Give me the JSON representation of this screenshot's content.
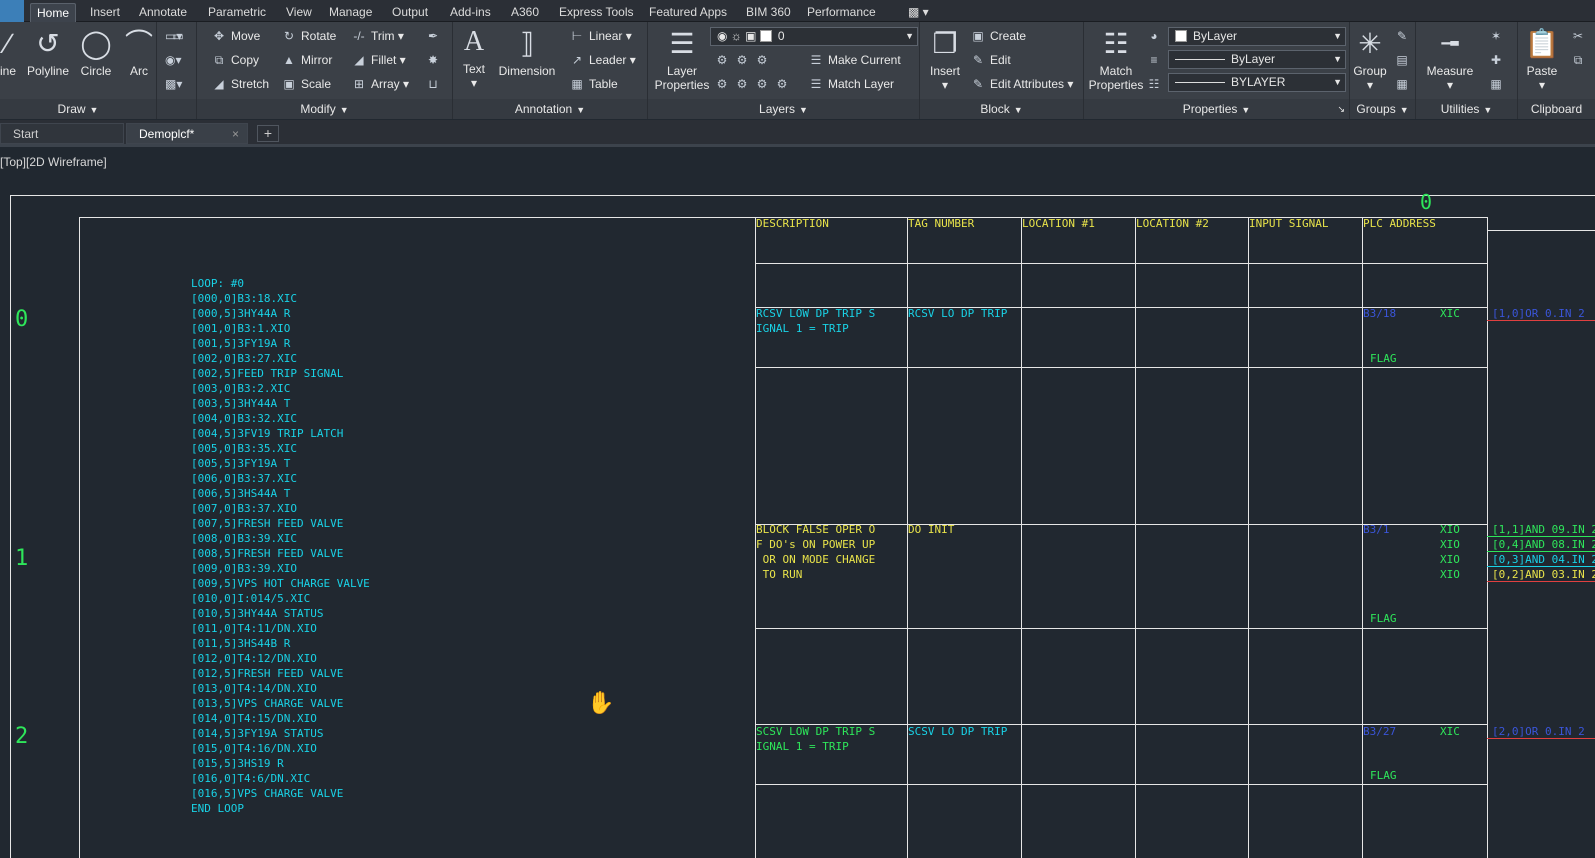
{
  "menu_tabs": [
    "Home",
    "Insert",
    "Annotate",
    "Parametric",
    "View",
    "Manage",
    "Output",
    "Add-ins",
    "A360",
    "Express Tools",
    "Featured Apps",
    "BIM 360",
    "Performance"
  ],
  "ribbon": {
    "draw": {
      "title": "Draw",
      "line": "ine",
      "polyline": "Polyline",
      "circle": "Circle",
      "arc": "Arc"
    },
    "modify": {
      "title": "Modify",
      "move": "Move",
      "rotate": "Rotate",
      "trim": "Trim",
      "copy": "Copy",
      "mirror": "Mirror",
      "fillet": "Fillet",
      "stretch": "Stretch",
      "scale": "Scale",
      "array": "Array"
    },
    "annotation": {
      "title": "Annotation",
      "text": "Text",
      "dimension": "Dimension",
      "linear": "Linear",
      "leader": "Leader",
      "table": "Table"
    },
    "layers": {
      "title": "Layers",
      "layer_properties_1": "Layer",
      "layer_properties_2": "Properties",
      "current_layer": "0",
      "make_current": "Make Current",
      "match_layer": "Match Layer"
    },
    "block": {
      "title": "Block",
      "insert": "Insert",
      "create": "Create",
      "edit": "Edit",
      "edit_attributes": "Edit Attributes"
    },
    "properties": {
      "title": "Properties",
      "match_1": "Match",
      "match_2": "Properties",
      "color": "ByLayer",
      "linetype": "ByLayer",
      "lineweight": "BYLAYER"
    },
    "groups": {
      "title": "Groups",
      "group": "Group"
    },
    "utilities": {
      "title": "Utilities",
      "measure": "Measure"
    },
    "clipboard": {
      "title": "Clipboard",
      "paste": "Paste"
    }
  },
  "doc_tabs": {
    "start": "Start",
    "active": "Demoplcf*",
    "close": "×",
    "add": "+"
  },
  "viewport_label": "[Top][2D Wireframe]",
  "rung_numbers": [
    "0",
    "1",
    "2"
  ],
  "top_marker": "0",
  "loop_text": [
    "LOOP: #0",
    "[000,0]B3:18.XIC",
    "[000,5]3HY44A R",
    "[001,0]B3:1.XIO",
    "[001,5]3FY19A R",
    "[002,0]B3:27.XIC",
    "[002,5]FEED TRIP SIGNAL",
    "[003,0]B3:2.XIC",
    "[003,5]3HY44A T",
    "[004,0]B3:32.XIC",
    "[004,5]3FV19 TRIP LATCH",
    "[005,0]B3:35.XIC",
    "[005,5]3FY19A T",
    "[006,0]B3:37.XIC",
    "[006,5]3HS44A T",
    "[007,0]B3:37.XIO",
    "[007,5]FRESH FEED VALVE",
    "[008,0]B3:39.XIC",
    "[008,5]FRESH FEED VALVE",
    "[009,0]B3:39.XIO",
    "[009,5]VPS HOT CHARGE VALVE",
    "[010,0]I:014/5.XIC",
    "[010,5]3HY44A STATUS",
    "[011,0]T4:11/DN.XIO",
    "[011,5]3HS44B R",
    "[012,0]T4:12/DN.XIO",
    "[012,5]FRESH FEED VALVE",
    "[013,0]T4:14/DN.XIO",
    "[013,5]VPS CHARGE VALVE",
    "[014,0]T4:15/DN.XIO",
    "[014,5]3FY19A STATUS",
    "[015,0]T4:16/DN.XIO",
    "[015,5]3HS19 R",
    "[016,0]T4:6/DN.XIC",
    "[016,5]VPS CHARGE VALVE",
    "END LOOP"
  ],
  "table_headers": [
    "DESCRIPTION",
    "TAG NUMBER",
    "LOCATION #1",
    "LOCATION #2",
    "INPUT SIGNAL",
    "PLC ADDRESS"
  ],
  "rows": [
    {
      "description": "RCSV LOW DP TRIP S\nIGNAL 1 = TRIP",
      "tag": "RCSV LO DP TRIP",
      "address": "B3/18",
      "instr": "XIC",
      "flag": "FLAG",
      "out": [
        "[1,0]OR 0.IN 2"
      ]
    },
    {
      "description": "BLOCK FALSE OPER O\nF DO's ON POWER UP\n OR ON MODE CHANGE\n TO RUN",
      "tag": "DO INIT",
      "address": "B3/1",
      "instr": "XIO\nXIO\nXIO\nXIO",
      "flag": "FLAG",
      "out": [
        "[1,1]AND 09.IN 2",
        "[0,4]AND 08.IN 2",
        "[0,3]AND 04.IN 2",
        "[0,2]AND 03.IN 2"
      ]
    },
    {
      "description": "SCSV LOW DP TRIP S\nIGNAL 1 = TRIP",
      "tag": "SCSV LO DP TRIP",
      "address": "B3/27",
      "instr": "XIC",
      "flag": "FLAG",
      "out": [
        "[2,0]OR 0.IN 2"
      ]
    }
  ]
}
